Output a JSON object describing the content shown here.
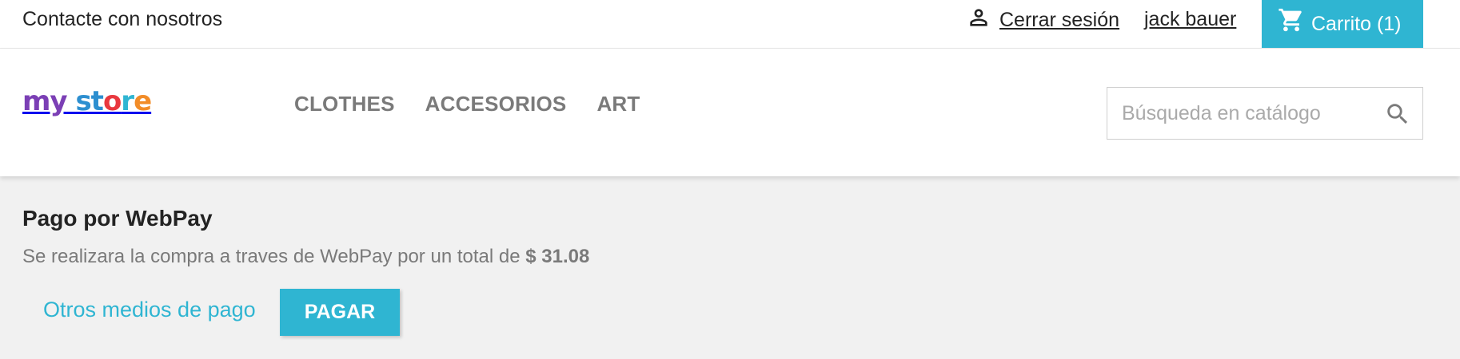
{
  "topbar": {
    "contact_label": "Contacte con nosotros",
    "logout_label": "Cerrar sesión",
    "account_name": "jack bauer",
    "cart_label": "Carrito (1)",
    "user_icon": "user-icon",
    "cart_icon": "shopping-cart-icon"
  },
  "header": {
    "logo": {
      "part1": "my",
      "part2": "st",
      "part3": "o",
      "part4": "r",
      "part5": "e"
    },
    "nav": [
      "CLOTHES",
      "ACCESORIOS",
      "ART"
    ],
    "search": {
      "placeholder": "Búsqueda en catálogo",
      "value": "",
      "icon": "search-icon"
    }
  },
  "main": {
    "title": "Pago por WebPay",
    "description": "Se realizara la compra a traves de WebPay por un total de ",
    "total": "$ 31.08",
    "other_methods_label": "Otros medios de pago",
    "pay_label": "PAGAR"
  },
  "colors": {
    "accent": "#2fb5d2",
    "background": "#f1f1f1",
    "text": "#232323",
    "muted": "#7a7a7a"
  }
}
